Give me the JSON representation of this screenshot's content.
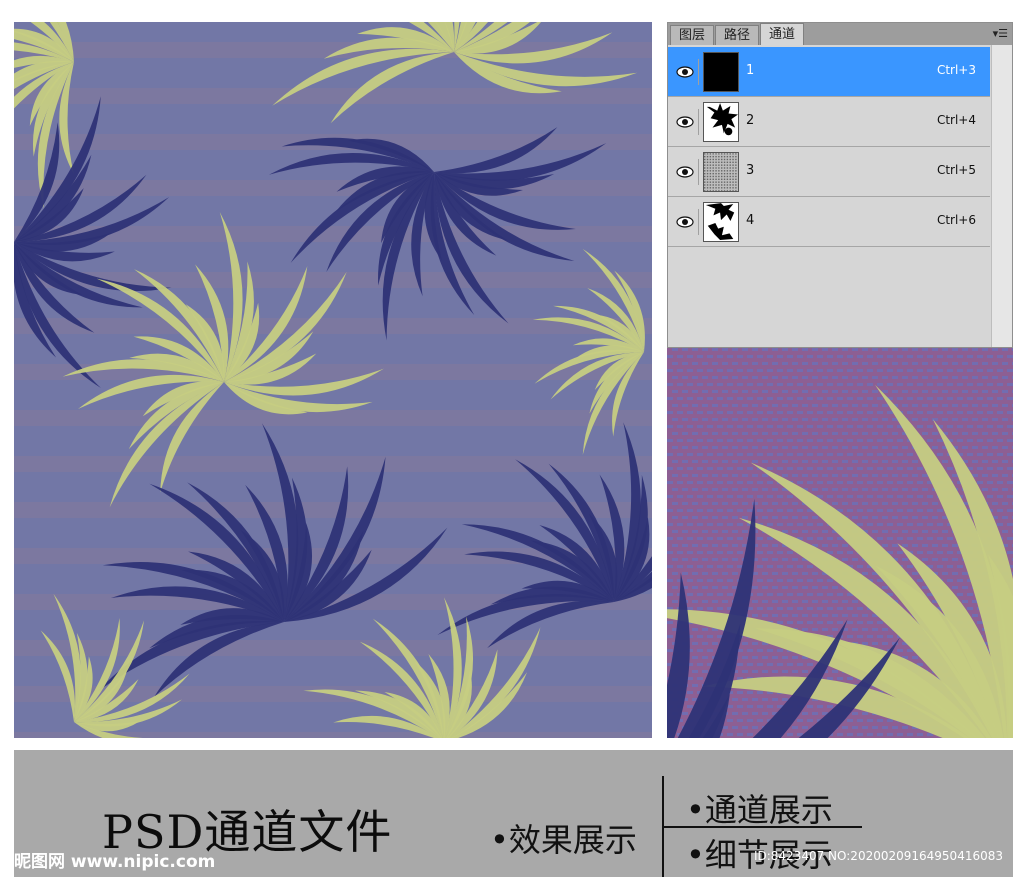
{
  "colors": {
    "background_blue": "#7277a6",
    "leaf_yellow": "#c6cd82",
    "leaf_navy": "#2e3376",
    "stripe": "#8a7a98",
    "selection": "#3a96ff"
  },
  "channels_panel": {
    "tabs": [
      {
        "label": "图层",
        "active": false
      },
      {
        "label": "路径",
        "active": false
      },
      {
        "label": "通道",
        "active": true
      }
    ],
    "menu_icon": "panel-menu-icon",
    "channels": [
      {
        "name": "1",
        "shortcut": "Ctrl+3",
        "selected": true,
        "thumbnail": "solid-black"
      },
      {
        "name": "2",
        "shortcut": "Ctrl+4",
        "selected": false,
        "thumbnail": "leaf-silhouette"
      },
      {
        "name": "3",
        "shortcut": "Ctrl+5",
        "selected": false,
        "thumbnail": "texture-grey"
      },
      {
        "name": "4",
        "shortcut": "Ctrl+6",
        "selected": false,
        "thumbnail": "leaf-silhouette"
      }
    ]
  },
  "footer": {
    "title": "PSD通道文件",
    "effect_label": "•效果展示",
    "channel_label": "•通道展示",
    "detail_label": "•细节展示",
    "logo_text": "昵图网 www.nipic.com",
    "image_id": "ID:8423407 NO:20200209164950416083"
  }
}
